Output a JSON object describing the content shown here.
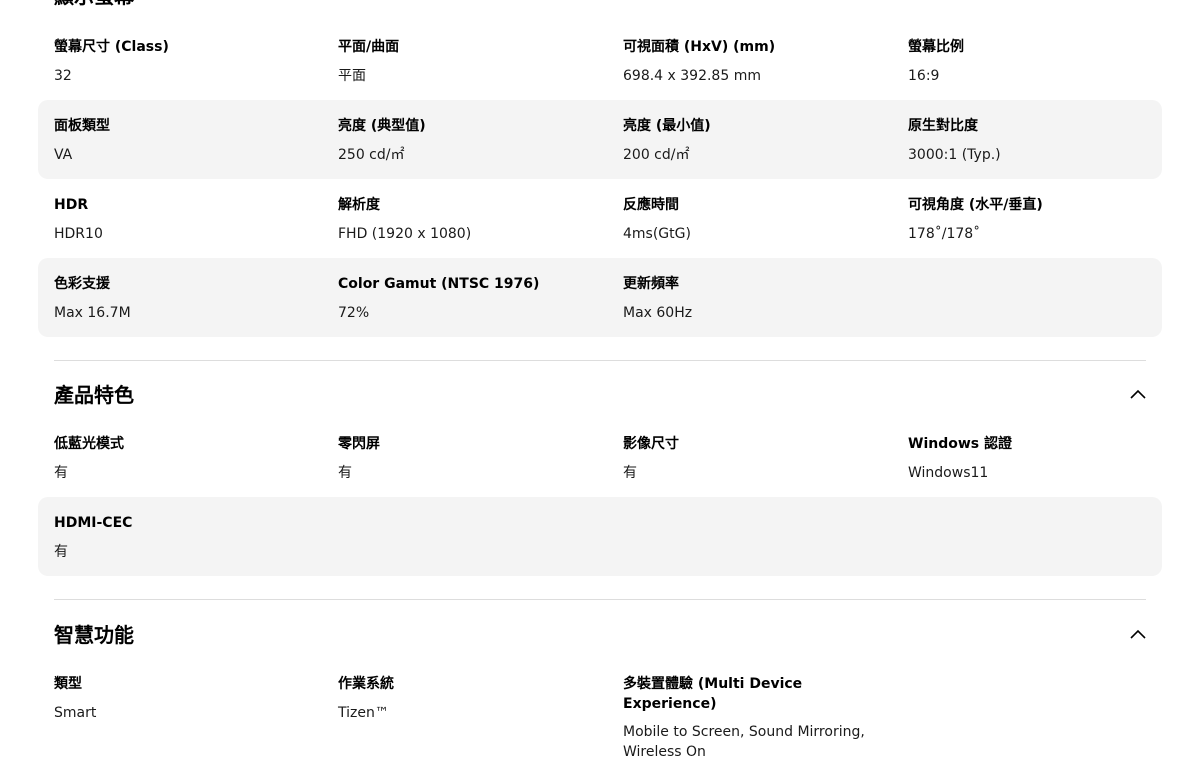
{
  "sections": {
    "display": {
      "title": "顯示螢幕",
      "rows": [
        [
          {
            "label": "螢幕尺寸 (Class)",
            "value": "32"
          },
          {
            "label": "平面/曲面",
            "value": "平面"
          },
          {
            "label": "可視面積 (HxV) (mm)",
            "value": "698.4 x 392.85 mm"
          },
          {
            "label": "螢幕比例",
            "value": "16:9"
          }
        ],
        [
          {
            "label": "面板類型",
            "value": "VA"
          },
          {
            "label": "亮度 (典型值)",
            "value": "250 cd/㎡"
          },
          {
            "label": "亮度 (最小值)",
            "value": "200 cd/㎡"
          },
          {
            "label": "原生對比度",
            "value": "3000:1 (Typ.)"
          }
        ],
        [
          {
            "label": "HDR",
            "value": "HDR10"
          },
          {
            "label": "解析度",
            "value": "FHD (1920 x 1080)"
          },
          {
            "label": "反應時間",
            "value": "4ms(GtG)"
          },
          {
            "label": "可視角度 (水平/垂直)",
            "value": "178˚/178˚"
          }
        ],
        [
          {
            "label": "色彩支援",
            "value": "Max 16.7M"
          },
          {
            "label": "Color Gamut (NTSC 1976)",
            "value": "72%"
          },
          {
            "label": "更新頻率",
            "value": "Max 60Hz"
          }
        ]
      ]
    },
    "features": {
      "title": "產品特色",
      "rows": [
        [
          {
            "label": "低藍光模式",
            "value": "有"
          },
          {
            "label": "零閃屏",
            "value": "有"
          },
          {
            "label": "影像尺寸",
            "value": "有"
          },
          {
            "label": "Windows 認證",
            "value": "Windows11"
          }
        ],
        [
          {
            "label": "HDMI-CEC",
            "value": "有"
          }
        ]
      ]
    },
    "smart": {
      "title": "智慧功能",
      "rows": [
        [
          {
            "label": "類型",
            "value": "Smart"
          },
          {
            "label": "作業系統",
            "value": "Tizen™"
          },
          {
            "label": "多裝置體驗 (Multi Device Experience)",
            "value": "Mobile to Screen, Sound Mirroring, Wireless On"
          }
        ]
      ]
    }
  },
  "icons": {
    "collapse": "chevron-up-icon"
  }
}
